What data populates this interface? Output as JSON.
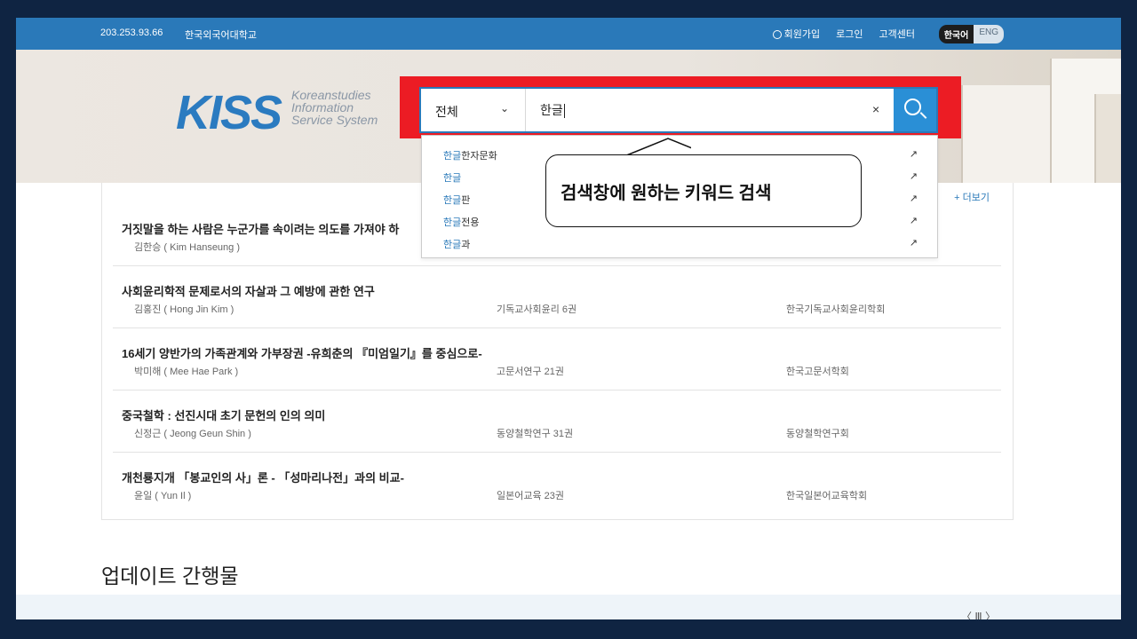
{
  "topbar": {
    "ip": "203.253.93.66",
    "university": "한국외국어대학교",
    "signup": "회원가입",
    "login": "로그인",
    "support": "고객센터",
    "lang_ko": "한국어",
    "lang_en": "ENG"
  },
  "logo": {
    "mark": "KISS",
    "line1": "Koreanstudies",
    "line2": "Information",
    "line3": "Service System"
  },
  "search": {
    "category": "전체",
    "query": "한글",
    "clear_icon": "×"
  },
  "suggestions": [
    {
      "hl": "한글",
      "rest": "한자문화"
    },
    {
      "hl": "한글",
      "rest": ""
    },
    {
      "hl": "한글",
      "rest": "판"
    },
    {
      "hl": "한글",
      "rest": "전용"
    },
    {
      "hl": "한글",
      "rest": "과"
    }
  ],
  "callout": "검색창에 원하는 키워드 검색",
  "more": "+ 더보기",
  "articles": [
    {
      "title": "거짓말을 하는 사람은 누군가를 속이려는 의도를 가져야 하",
      "author": "김한승 ( Kim Hanseung )",
      "journal": "",
      "publisher": ""
    },
    {
      "title": "사회윤리학적 문제로서의 자살과 그 예방에 관한 연구",
      "author": "김홍진 ( Hong Jin Kim )",
      "journal": "기독교사회윤리 6권",
      "publisher": "한국기독교사회윤리학회"
    },
    {
      "title": "16세기 양반가의 가족관계와 가부장권 -유희춘의 『미엄일기』를 중심으로-",
      "author": "박미해 ( Mee Hae Park )",
      "journal": "고문서연구 21권",
      "publisher": "한국고문서학회"
    },
    {
      "title": "중국철학 : 선진시대 초기 문헌의 인의 의미",
      "author": "신정근 ( Jeong Geun Shin )",
      "journal": "동양철학연구 31권",
      "publisher": "동양철학연구회"
    },
    {
      "title": "개천룡지개 「봉교인의 사」론 - 「성마리나전」과의 비교-",
      "author": "윤일 ( Yun Il )",
      "journal": "일본어교육 23권",
      "publisher": "한국일본어교육학회"
    }
  ],
  "updates_heading": "업데이트 간행물",
  "pager": "〈  Ⅲ  〉"
}
